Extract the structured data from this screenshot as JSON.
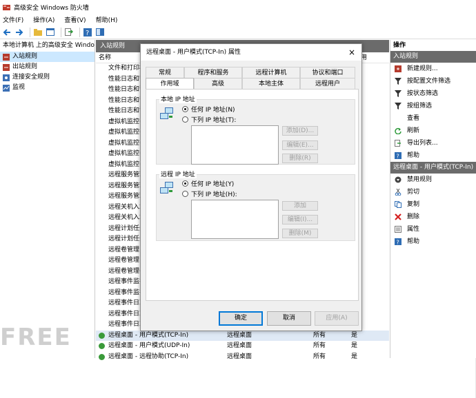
{
  "window": {
    "title": "高级安全 Windows 防火墙"
  },
  "menu": [
    "文件(F)",
    "操作(A)",
    "查看(V)",
    "帮助(H)"
  ],
  "tree": {
    "root": "本地计算机 上的高级安全 Windo",
    "items": [
      "入站规则",
      "出站规则",
      "连接安全规则",
      "监视"
    ]
  },
  "center": {
    "header": "入站规则",
    "col_name": "名称",
    "col_extra": "用",
    "rows": [
      {
        "name": "文件和打印机",
        "group": "",
        "profile": "",
        "enabled": ""
      },
      {
        "name": "性能日志和警",
        "group": "",
        "profile": "",
        "enabled": ""
      },
      {
        "name": "性能日志和警",
        "group": "",
        "profile": "",
        "enabled": ""
      },
      {
        "name": "性能日志和警",
        "group": "",
        "profile": "",
        "enabled": ""
      },
      {
        "name": "性能日志和警",
        "group": "",
        "profile": "",
        "enabled": ""
      },
      {
        "name": "虚拟机监控(",
        "group": "",
        "profile": "",
        "enabled": ""
      },
      {
        "name": "虚拟机监控(",
        "group": "",
        "profile": "",
        "enabled": ""
      },
      {
        "name": "虚拟机监控(",
        "group": "",
        "profile": "",
        "enabled": ""
      },
      {
        "name": "虚拟机监控(",
        "group": "",
        "profile": "",
        "enabled": ""
      },
      {
        "name": "虚拟机监控(",
        "group": "",
        "profile": "",
        "enabled": ""
      },
      {
        "name": "远程服务管理",
        "group": "",
        "profile": "",
        "enabled": ""
      },
      {
        "name": "远程服务管理",
        "group": "",
        "profile": "",
        "enabled": ""
      },
      {
        "name": "远程服务管理",
        "group": "",
        "profile": "",
        "enabled": ""
      },
      {
        "name": "远程关机入站",
        "group": "",
        "profile": "",
        "enabled": ""
      },
      {
        "name": "远程关机入站",
        "group": "",
        "profile": "",
        "enabled": ""
      },
      {
        "name": "远程计划任务",
        "group": "",
        "profile": "",
        "enabled": ""
      },
      {
        "name": "远程计划任务",
        "group": "",
        "profile": "",
        "enabled": ""
      },
      {
        "name": "远程卷管理 -",
        "group": "",
        "profile": "",
        "enabled": ""
      },
      {
        "name": "远程卷管理 -",
        "group": "",
        "profile": "",
        "enabled": ""
      },
      {
        "name": "远程卷管理(",
        "group": "",
        "profile": "",
        "enabled": ""
      },
      {
        "name": "远程事件监视",
        "group": "",
        "profile": "",
        "enabled": ""
      },
      {
        "name": "远程事件监视",
        "group": "",
        "profile": "",
        "enabled": ""
      },
      {
        "name": "远程事件日志",
        "group": "",
        "profile": "",
        "enabled": ""
      },
      {
        "name": "远程事件日志",
        "group": "",
        "profile": "",
        "enabled": ""
      },
      {
        "name": "远程事件日志",
        "group": "",
        "profile": "",
        "enabled": ""
      },
      {
        "name": "远程桌面 - 用户模式(TCP-In)",
        "group": "远程桌面",
        "profile": "所有",
        "enabled": "是"
      },
      {
        "name": "远程桌面 - 用户模式(UDP-In)",
        "group": "远程桌面",
        "profile": "所有",
        "enabled": "是"
      },
      {
        "name": "远程桌面 - 远程协助(TCP-In)",
        "group": "远程桌面",
        "profile": "所有",
        "enabled": "是"
      }
    ]
  },
  "actions": {
    "header": "操作",
    "section1": "入站规则",
    "items1": [
      "新建规则...",
      "按配置文件筛选",
      "按状态筛选",
      "按组筛选",
      "查看",
      "刷新",
      "导出列表...",
      "帮助"
    ],
    "section2": "远程桌面 - 用户模式(TCP-In)",
    "items2": [
      "禁用规则",
      "剪切",
      "复制",
      "删除",
      "属性",
      "帮助"
    ]
  },
  "dialog": {
    "title": "远程桌面 - 用户模式(TCP-In) 属性",
    "close": "×",
    "tabs_row1": [
      "常规",
      "程序和服务",
      "远程计算机",
      "协议和端口"
    ],
    "tabs_row2": [
      "作用域",
      "高级",
      "本地主体",
      "远程用户"
    ],
    "local": {
      "label": "本地 IP 地址",
      "any": "任何 IP 地址(N)",
      "list": "下列 IP 地址(T):",
      "add": "添加(D)...",
      "edit": "编辑(E)...",
      "remove": "删除(R)"
    },
    "remote": {
      "label": "远程 IP 地址",
      "any": "任何 IP 地址(Y)",
      "list": "下列 IP 地址(H):",
      "add": "添加",
      "edit": "编辑(I)...",
      "remove": "删除(M)"
    },
    "ok": "确定",
    "cancel": "取消",
    "apply": "应用(A)"
  },
  "watermark": "FREE"
}
